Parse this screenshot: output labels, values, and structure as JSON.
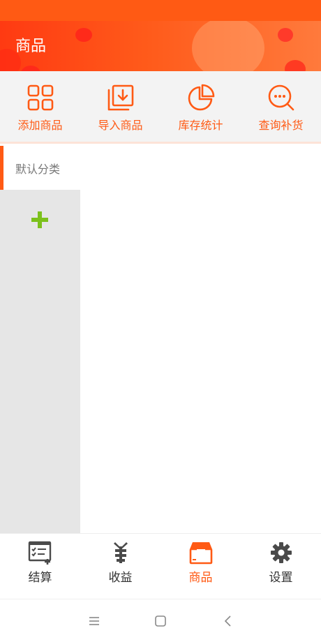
{
  "header": {
    "title": "商品"
  },
  "actions": [
    {
      "label": "添加商品",
      "icon": "grid-icon"
    },
    {
      "label": "导入商品",
      "icon": "import-icon"
    },
    {
      "label": "库存统计",
      "icon": "pie-chart-icon"
    },
    {
      "label": "查询补货",
      "icon": "search-chat-icon"
    }
  ],
  "categories": [
    {
      "label": "默认分类",
      "selected": true
    }
  ],
  "bottom_nav": [
    {
      "label": "结算",
      "icon": "checkout-icon",
      "active": false
    },
    {
      "label": "收益",
      "icon": "earnings-icon",
      "active": false
    },
    {
      "label": "商品",
      "icon": "box-icon",
      "active": true
    },
    {
      "label": "设置",
      "icon": "gear-icon",
      "active": false
    }
  ],
  "colors": {
    "accent": "#ff5a14",
    "add_green": "#7cc11c",
    "nav_icon": "#4a4a4a"
  }
}
